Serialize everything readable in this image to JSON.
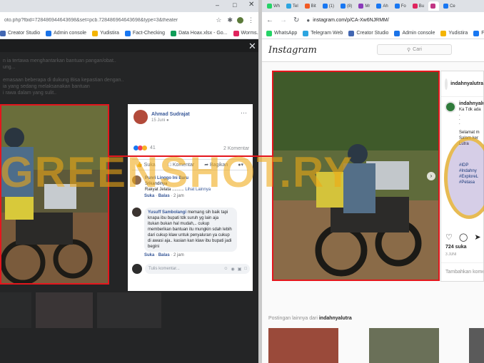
{
  "left_browser": {
    "url": "oto.php?fbid=728486944643698&set=pcb.728486964643698&type=3&theater",
    "bookmarks": [
      {
        "label": "Creator Studio",
        "color": "#4267b2"
      },
      {
        "label": "Admin console",
        "color": "#1a73e8"
      },
      {
        "label": "Yudistira",
        "color": "#f4b400"
      },
      {
        "label": "Fact-Checking",
        "color": "#1877f2"
      },
      {
        "label": "Data Hoax.xlsx - Go...",
        "color": "#0f9d58"
      },
      {
        "label": "Worms.Zone - Play...",
        "color": "#e0245e"
      }
    ],
    "bg_text_lines": [
      "n ia tertawa menghantarkan bantuan pangan/obat..",
      "ung...",
      "",
      "emasaan beberapa di dukung Bisa kepastian dengan..",
      "ia yang sedang melaksanakan bantuan",
      "i rawa dalam yang sulit.."
    ]
  },
  "fb_post": {
    "author": "Ahmad Sudrajat",
    "date": "15 Juni",
    "reaction_count": "41",
    "comment_count": "2 Komentar",
    "actions": {
      "like": "Suka",
      "comment": "Komentar",
      "share": "Bagikan"
    },
    "comments": [
      {
        "author": "Punri Linggo Ini Baru",
        "text_lines": [
          "Srikandinya",
          "Rakyat Jelata .........."
        ],
        "see_more": "Lihat Lainnya",
        "like": "Suka",
        "reply": "Balas",
        "time": "2 jam"
      },
      {
        "author": "Yusuff Sambolangi",
        "text_lines": [
          "memang sih baik tapi",
          "knapa ibu bupati tdk suruh yg lain aja",
          "itukan bukan hal mudah,.. cukup",
          "memberikan bantuan itu mungkin sdah lebih",
          "dari cukup klaw untuk penyaluran ya cukup",
          "di awasi aja.. kasian kan klaw ibu bupati jadi",
          "begini"
        ],
        "like": "Suka",
        "reply": "Balas",
        "time": "2 jam"
      }
    ],
    "comment_placeholder": "Tulis komentar..."
  },
  "right_browser": {
    "tabs": [
      "Wh",
      "Tel",
      "Bit",
      "(1)",
      "(8)",
      "Mr",
      "Ah",
      "Fo",
      "Bu",
      "",
      "Ce"
    ],
    "url": "instagram.com/p/CA-Xw6NJRMM/",
    "bookmarks": [
      {
        "label": "WhatsApp",
        "color": "#25d366"
      },
      {
        "label": "Telegram Web",
        "color": "#2ca5e0"
      },
      {
        "label": "Creator Studio",
        "color": "#4267b2"
      },
      {
        "label": "Admin console",
        "color": "#1a73e8"
      },
      {
        "label": "Yudistira",
        "color": "#f4b400"
      },
      {
        "label": "Fact-Checking",
        "color": "#1877f2"
      }
    ]
  },
  "instagram": {
    "logo": "Instagram",
    "search_placeholder": "Cari",
    "username": "indahnyalutra",
    "username_short": "indahnyalu",
    "caption_short": "Ka Tdk ada",
    "caption_lines": [
      "Selamat m",
      "Salam ker",
      "Lutra"
    ],
    "hashtags": [
      "#IDP",
      "#Indahny",
      "#ExploreL",
      "#Petasa"
    ],
    "likes": "724 suka",
    "time": "3 JUNI",
    "add_comment": "Tambahkan komen",
    "more_posts_prefix": "Postingan lainnya dari",
    "more_posts_user": "indahnyalutra"
  },
  "watermark": "GREENSHOT.RY"
}
